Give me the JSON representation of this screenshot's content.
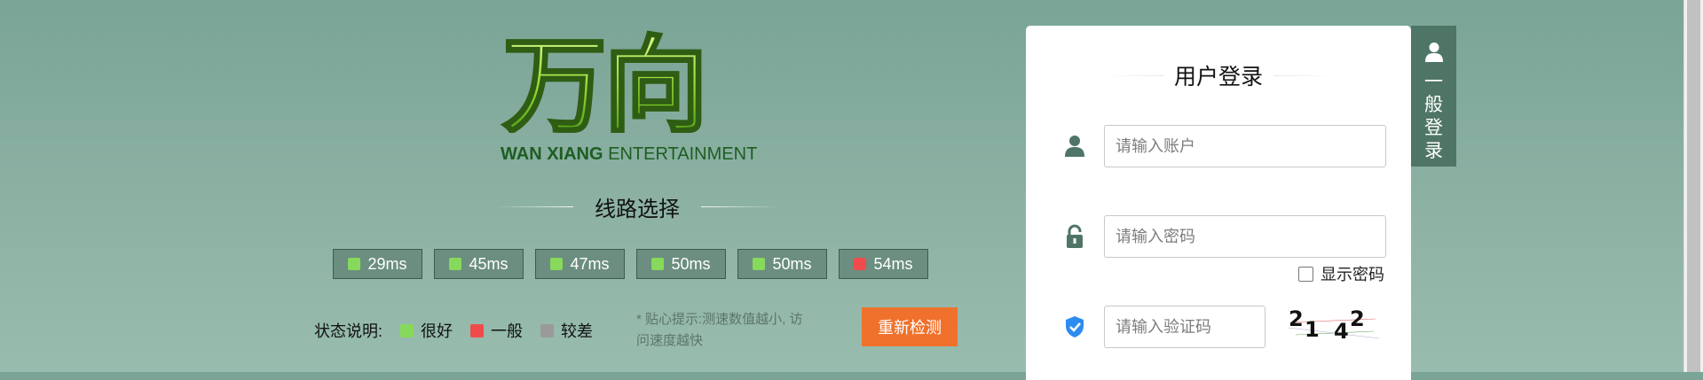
{
  "logo": {
    "chars": "万向",
    "sub_bold": "WAN XIANG",
    "sub_light": "ENTERTAINMENT"
  },
  "route_section": {
    "title": "线路选择"
  },
  "routes": [
    {
      "latency": "29ms",
      "status_color": "#86d95a"
    },
    {
      "latency": "45ms",
      "status_color": "#86d95a"
    },
    {
      "latency": "47ms",
      "status_color": "#86d95a"
    },
    {
      "latency": "50ms",
      "status_color": "#86d95a"
    },
    {
      "latency": "50ms",
      "status_color": "#86d95a"
    },
    {
      "latency": "54ms",
      "status_color": "#f04b4b"
    }
  ],
  "legend": {
    "label": "状态说明:",
    "items": [
      {
        "label": "很好",
        "color": "#86d95a"
      },
      {
        "label": "一般",
        "color": "#f04b4b"
      },
      {
        "label": "较差",
        "color": "#9a9a9a"
      }
    ]
  },
  "tip": "* 贴心提示:测速数值越小, 访问速度越快",
  "recheck_label": "重新检测",
  "login": {
    "title": "用户登录",
    "account_placeholder": "请输入账户",
    "password_placeholder": "请输入密码",
    "show_password_label": "显示密码",
    "captcha_placeholder": "请输入验证码",
    "captcha_digits": [
      "2",
      "1",
      "4",
      "2"
    ]
  },
  "side_tab": {
    "label": "一般登录"
  },
  "icons": [
    "user-icon",
    "lock-icon",
    "shield-check-icon",
    "person-icon"
  ],
  "colors": {
    "accent": "#f0712b",
    "side_tab": "#4f7566",
    "route_bg": "#6b8e80"
  }
}
